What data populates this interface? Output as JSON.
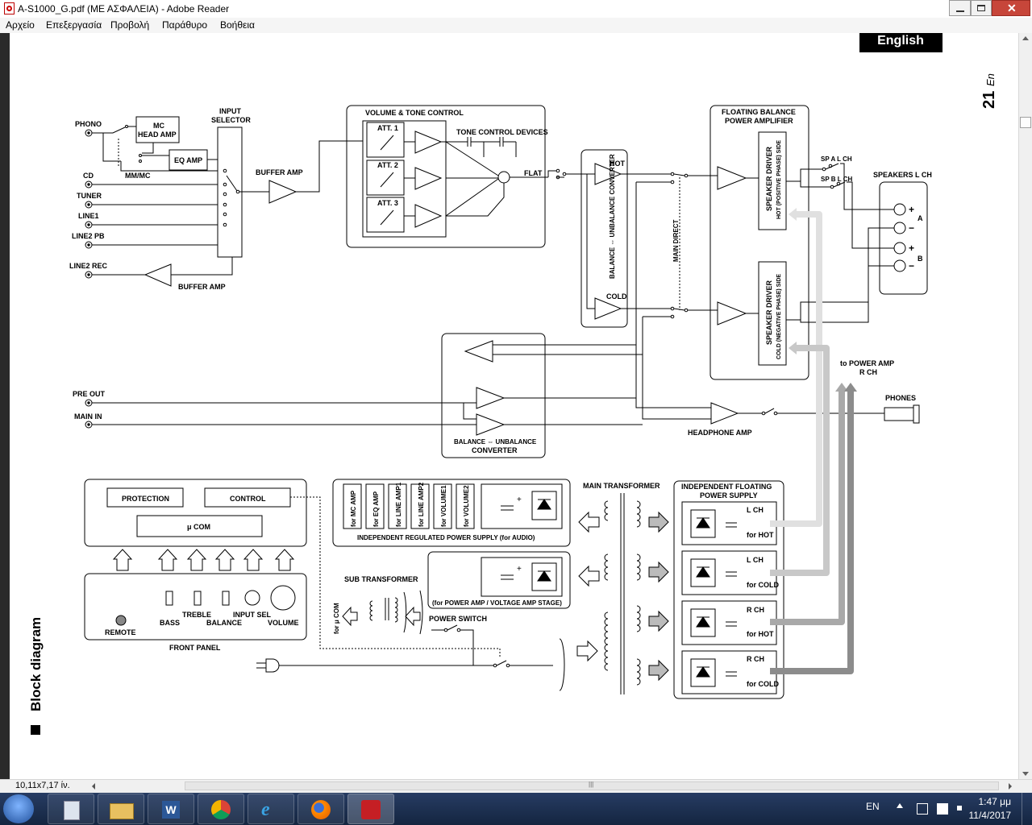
{
  "window": {
    "title": "A-S1000_G.pdf (ΜΕ ΑΣΦΑΛΕΙΑ) - Adobe Reader",
    "controls": [
      "minimize",
      "maximize",
      "close"
    ]
  },
  "menu": [
    "Αρχείο",
    "Επεξεργασία",
    "Προβολή",
    "Παράθυρο",
    "Βοήθεια"
  ],
  "page": {
    "lang_tab": "English",
    "page_number": "21",
    "page_suffix": "En",
    "section_title": "Block diagram"
  },
  "diagram": {
    "inputs": [
      "PHONO",
      "CD",
      "TUNER",
      "LINE1",
      "LINE2 PB",
      "LINE2 REC",
      "PRE OUT",
      "MAIN IN"
    ],
    "mc_head_amp": [
      "MC",
      "HEAD AMP"
    ],
    "eq_amp": "EQ AMP",
    "mm_mc": "MM/MC",
    "input_selector": [
      "INPUT",
      "SELECTOR"
    ],
    "buffer_amp": "BUFFER AMP",
    "volume_tone": {
      "title": "VOLUME & TONE CONTROL",
      "atts": [
        "ATT. 1",
        "ATT. 2",
        "ATT. 3"
      ],
      "tone_devices": "TONE CONTROL DEVICES",
      "flat": "FLAT"
    },
    "bal_conv_main": {
      "text": "BALANCE ⇔ UNBALANCE CONVERTER",
      "hot": "HOT",
      "cold": "COLD"
    },
    "main_direct": "MAIN DIRECT",
    "floating_amp": {
      "title": [
        "FLOATING BALANCE",
        "POWER AMPLIFIER"
      ],
      "hot_driver": [
        "SPEAKER DRIVER",
        "HOT (POSITIVE PHASE) SIDE"
      ],
      "cold_driver": [
        "SPEAKER DRIVER",
        "COLD (NEGATIVE PHASE) SIDE"
      ]
    },
    "sp_a": "SP A L CH",
    "sp_b": "SP B L CH",
    "speakers": {
      "title": "SPEAKERS L CH",
      "terminals": [
        "+",
        "−",
        "+",
        "−"
      ],
      "groups": [
        "A",
        "B"
      ]
    },
    "to_power_amp": [
      "to POWER AMP",
      "R CH"
    ],
    "phones": "PHONES",
    "headphone_amp": "HEADPHONE AMP",
    "bal_conv_bottom": [
      "BALANCE ⇔ UNBALANCE",
      "CONVERTER"
    ],
    "protection": "PROTECTION",
    "control": "CONTROL",
    "ucom": "μ COM",
    "front_panel": {
      "title": "FRONT PANEL",
      "remote": "REMOTE",
      "bass": "BASS",
      "treble": "TREBLE",
      "balance": "BALANCE",
      "input_sel": "INPUT SEL",
      "volume": "VOLUME"
    },
    "reg_supply": {
      "title": "INDEPENDENT REGULATED POWER SUPPLY (for AUDIO)",
      "items": [
        "for MC AMP",
        "for EQ AMP",
        "for LINE AMP1",
        "for LINE AMP2",
        "for VOLUME1",
        "for VOLUME2"
      ]
    },
    "power_amp_stage": "(for POWER AMP / VOLTAGE AMP STAGE)",
    "sub_transformer": "SUB TRANSFORMER",
    "for_ucom": "for μ COM",
    "power_switch": "POWER SWITCH",
    "main_transformer": "MAIN TRANSFORMER",
    "float_supply": {
      "title": [
        "INDEPENDENT FLOATING",
        "POWER SUPPLY"
      ],
      "units": [
        {
          "ch": "L CH",
          "side": "for HOT"
        },
        {
          "ch": "L CH",
          "side": "for COLD"
        },
        {
          "ch": "R CH",
          "side": "for HOT"
        },
        {
          "ch": "R CH",
          "side": "for COLD"
        }
      ]
    }
  },
  "statusbar": {
    "page_size": "10,11x7,17 ίν."
  },
  "taskbar": {
    "apps": [
      "start-button",
      "calculator-icon",
      "file-explorer-icon",
      "word-icon",
      "chrome-icon",
      "internet-explorer-icon",
      "firefox-icon",
      "adobe-reader-icon"
    ],
    "lang": "EN",
    "time": "1:47 μμ",
    "date": "11/4/2017"
  }
}
